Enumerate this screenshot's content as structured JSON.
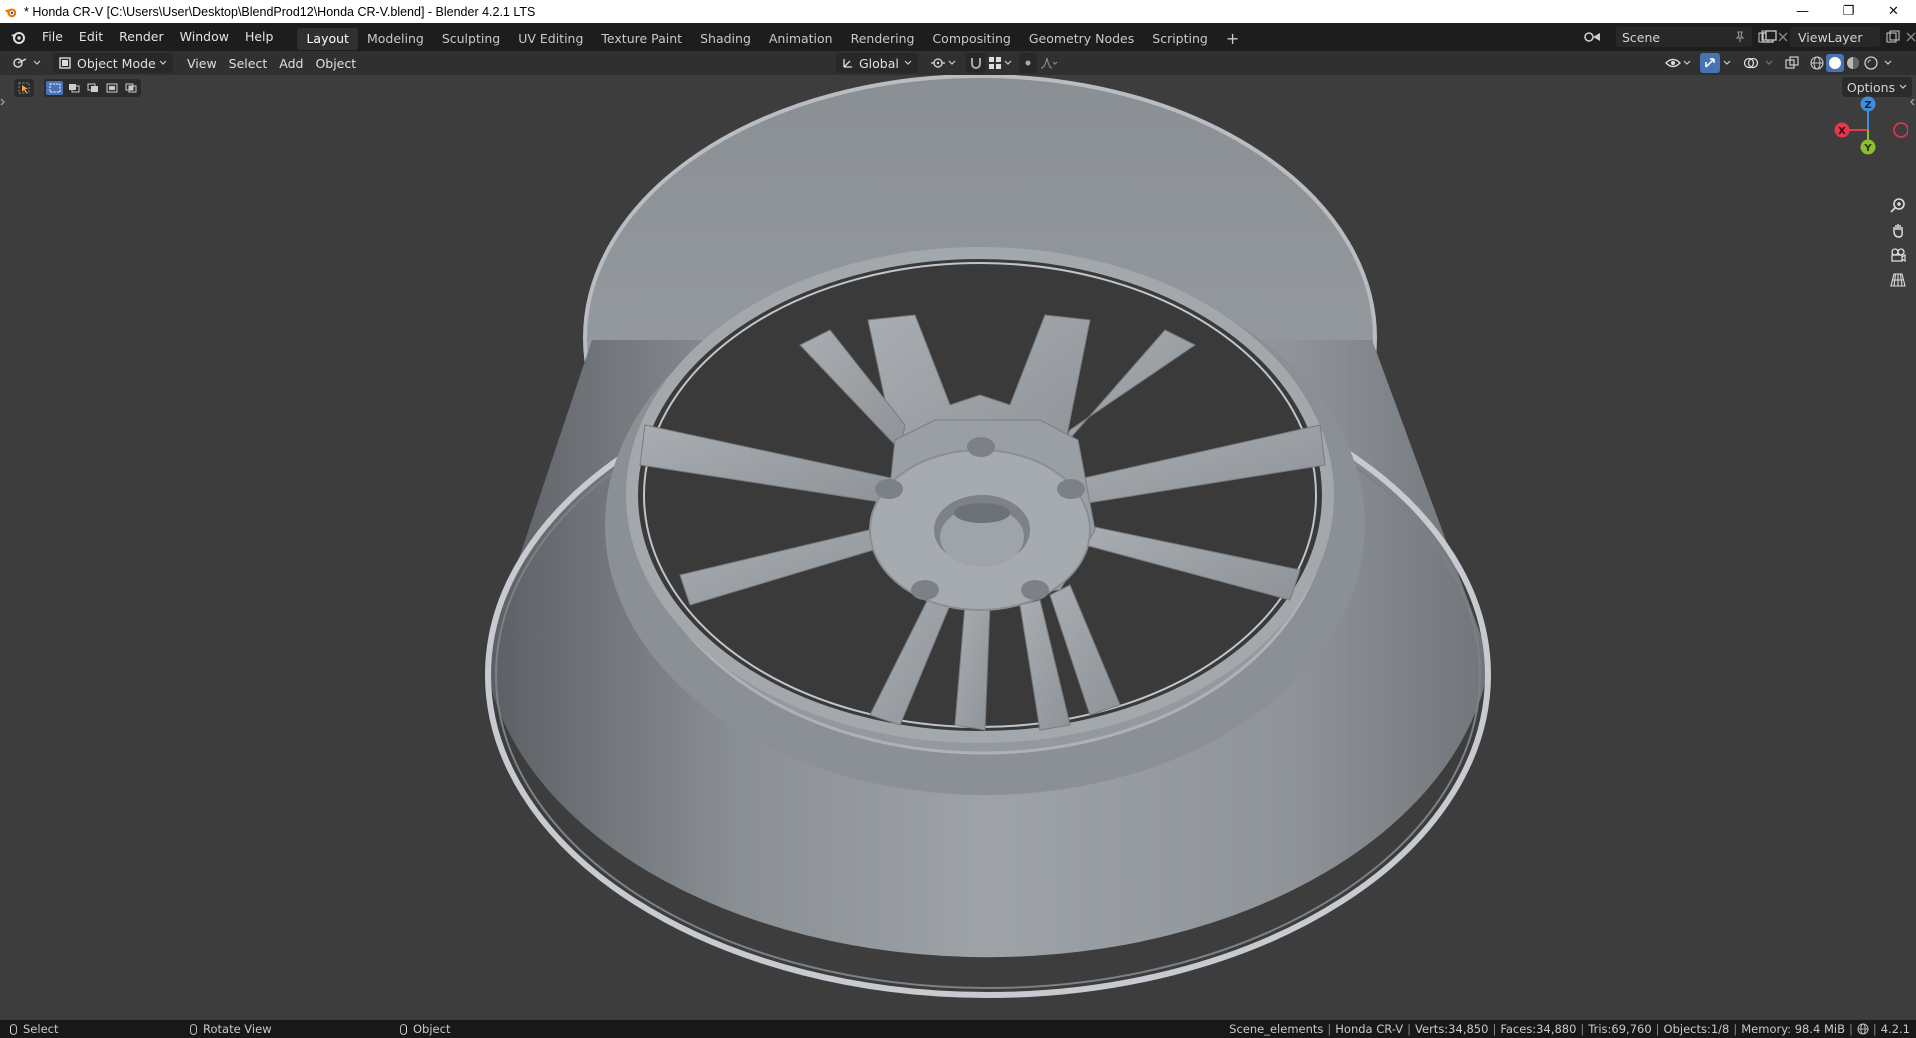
{
  "window": {
    "title": "* Honda CR-V [C:\\Users\\User\\Desktop\\BlendProd12\\Honda CR-V.blend] - Blender 4.2.1 LTS",
    "minimize": "—",
    "restore": "❐",
    "close": "✕"
  },
  "menus": [
    "File",
    "Edit",
    "Render",
    "Window",
    "Help"
  ],
  "workspaces": [
    "Layout",
    "Modeling",
    "Sculpting",
    "UV Editing",
    "Texture Paint",
    "Shading",
    "Animation",
    "Rendering",
    "Compositing",
    "Geometry Nodes",
    "Scripting"
  ],
  "active_workspace": "Layout",
  "add_workspace": "+",
  "scene": {
    "label": "Scene"
  },
  "view_layer": {
    "label": "ViewLayer"
  },
  "viewport_header": {
    "mode": "Object Mode",
    "menus": [
      "View",
      "Select",
      "Add",
      "Object"
    ],
    "transform_orientation": "Global",
    "options_label": "Options"
  },
  "gizmo": {
    "x": "X",
    "y": "Y",
    "z": "Z"
  },
  "status": {
    "left_click": "Select",
    "middle_click": "Rotate View",
    "right_click": "Object",
    "collection": "Scene_elements",
    "object": "Honda CR-V",
    "verts": "Verts:34,850",
    "faces": "Faces:34,880",
    "tris": "Tris:69,760",
    "objects": "Objects:1/8",
    "memory": "Memory: 98.4 MiB",
    "version": "4.2.1"
  },
  "colors": {
    "accent": "#4772b3",
    "axis_x": "#e2394f",
    "axis_y": "#8bc02a",
    "axis_z": "#3f8fda",
    "viewport_bg": "#3d3d3d"
  }
}
